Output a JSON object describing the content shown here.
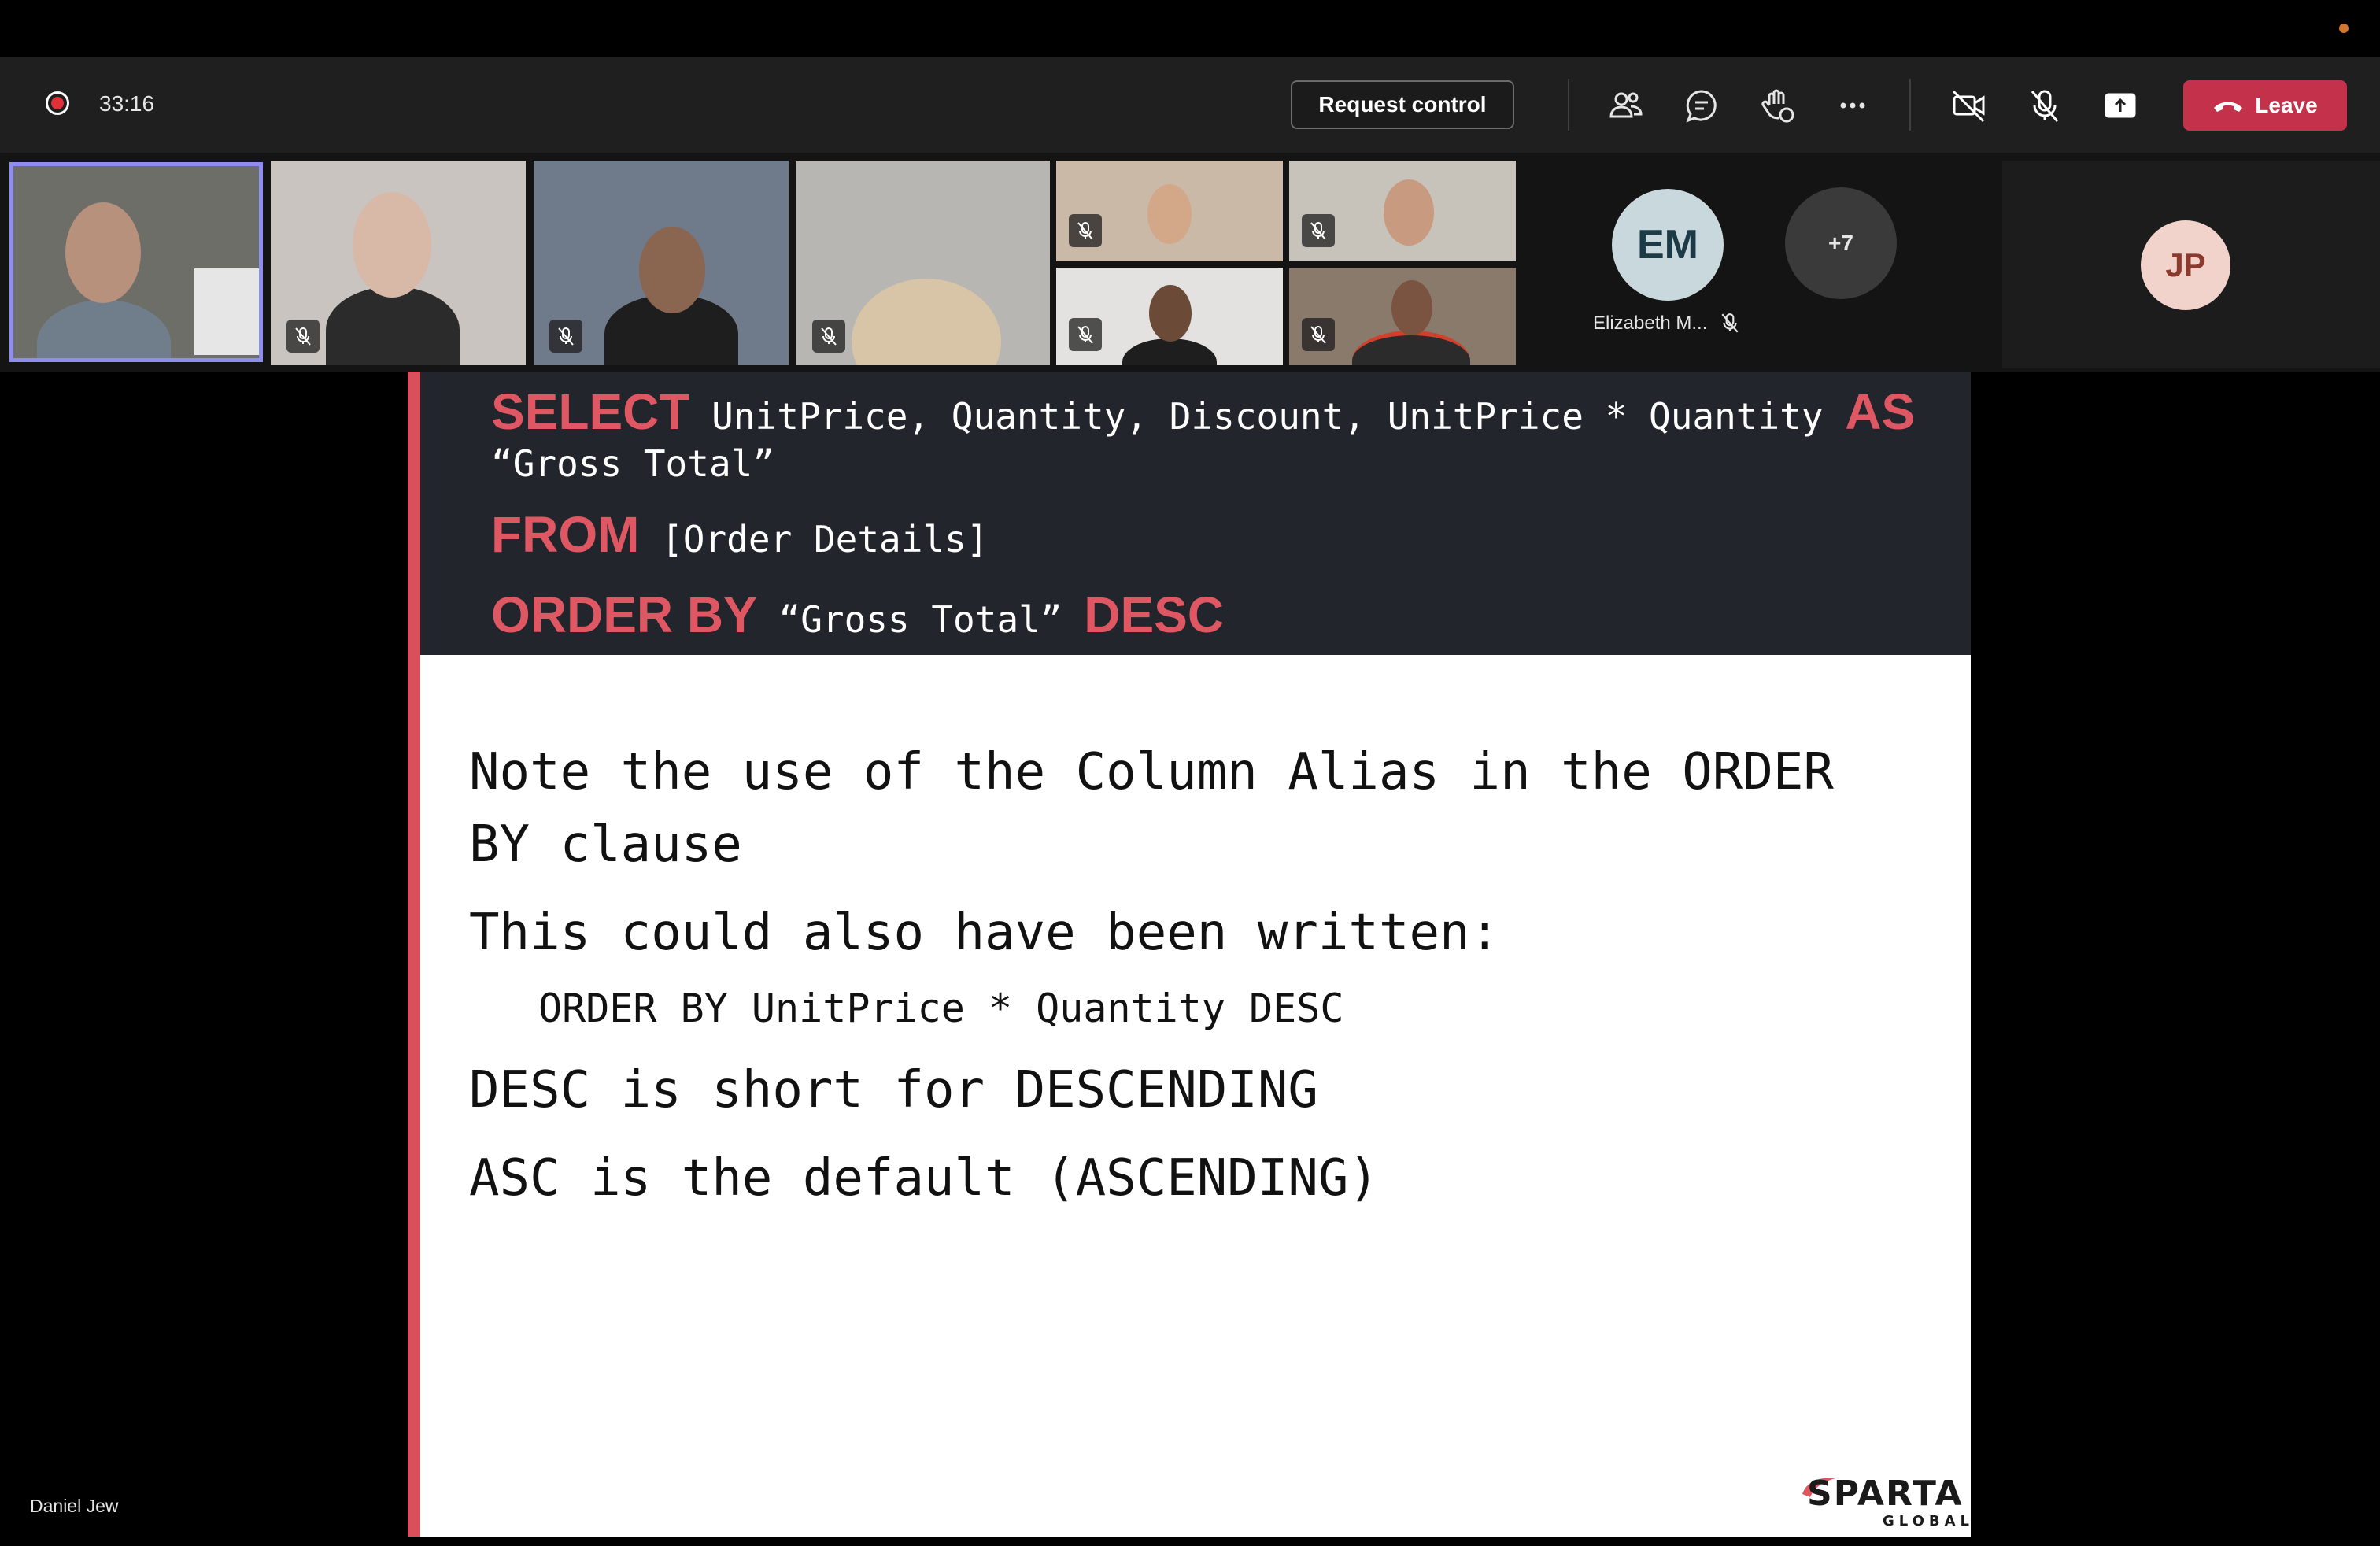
{
  "meeting": {
    "timer": "33:16",
    "request_control_label": "Request control",
    "leave_label": "Leave"
  },
  "toolbar_icons": [
    "participants-icon",
    "chat-icon",
    "reactions-icon",
    "more-options-icon",
    "camera-off-icon",
    "mic-off-icon",
    "share-screen-icon"
  ],
  "participants": {
    "em_initials": "EM",
    "em_name": "Elizabeth M...",
    "more_count": "+7",
    "jp_initials": "JP"
  },
  "colors": {
    "leave": "#c4314b",
    "slide_accent": "#d9505c",
    "keyword": "#e05764",
    "active_speaker_border": "#8f8ef0"
  },
  "stage": {
    "presenter_name": "Daniel Jew"
  },
  "slide": {
    "code": {
      "kw_select": "SELECT",
      "line1_rest": " UnitPrice, Quantity, Discount, UnitPrice * Quantity ",
      "kw_as": "AS",
      "line2": "“Gross Total”",
      "kw_from": "FROM",
      "line3_rest": " [Order Details]",
      "kw_order_by": "ORDER BY",
      "line4_mid": " “Gross Total” ",
      "kw_desc": "DESC"
    },
    "notes": {
      "line1": "Note the use of the Column Alias in the ORDER",
      "line2": "BY clause",
      "line3": "This could also have been written:",
      "line4": "ORDER BY UnitPrice * Quantity DESC",
      "line5": "DESC is short for DESCENDING",
      "line6": "ASC is the default (ASCENDING)"
    },
    "logo_main": "SPARTA",
    "logo_sub": "GLOBAL"
  }
}
